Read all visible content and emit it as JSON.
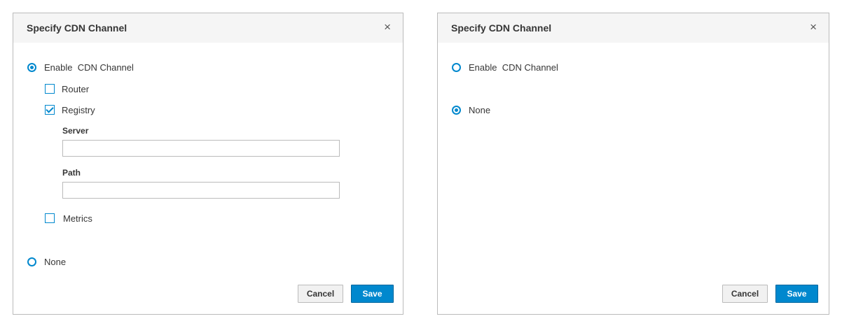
{
  "colors": {
    "accent": "#0088ce",
    "header_bg": "#f5f5f5",
    "border": "#bbbbbb"
  },
  "dialog_left": {
    "title": "Specify CDN Channel",
    "close_icon": "×",
    "enable_label": "Enable  CDN Channel",
    "enable_checked": true,
    "options": {
      "router": {
        "label": "Router",
        "checked": false
      },
      "registry": {
        "label": "Registry",
        "checked": true
      },
      "metrics": {
        "label": "Metrics",
        "checked": false
      }
    },
    "server": {
      "label": "Server",
      "value": "",
      "placeholder": ""
    },
    "path": {
      "label": "Path",
      "value": "",
      "placeholder": ""
    },
    "none_label": "None",
    "none_checked": false,
    "cancel_label": "Cancel",
    "save_label": "Save"
  },
  "dialog_right": {
    "title": "Specify CDN Channel",
    "close_icon": "×",
    "enable_label": "Enable  CDN Channel",
    "enable_checked": false,
    "none_label": "None",
    "none_checked": true,
    "cancel_label": "Cancel",
    "save_label": "Save"
  }
}
